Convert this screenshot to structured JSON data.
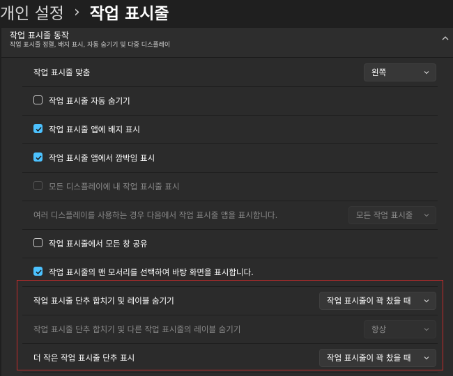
{
  "breadcrumb": {
    "parent": "개인 설정",
    "separator": "›",
    "current": "작업 표시줄"
  },
  "section": {
    "title": "작업 표시줄 동작",
    "subtitle": "작업 표시줄 정렬, 배지 표시, 자동 숨기기 및 다중 디스플레이"
  },
  "rows": {
    "alignment": {
      "label": "작업 표시줄 맞춤",
      "value": "왼쪽"
    },
    "autohide": {
      "label": "작업 표시줄 자동 숨기기",
      "checked": false
    },
    "badges": {
      "label": "작업 표시줄 앱에 배지 표시",
      "checked": true
    },
    "flashing": {
      "label": "작업 표시줄 앱에서 깜박임 표시",
      "checked": true
    },
    "all_displays": {
      "label": "모든 디스플레이에 내 작업 표시줄 표시",
      "checked": false,
      "disabled": true
    },
    "multi_display": {
      "label": "여러 디스플레이를 사용하는 경우 다음에서 작업 표시줄 앱을 표시합니다.",
      "value": "모든 작업 표시줄",
      "disabled": true
    },
    "share_window": {
      "label": "작업 표시줄에서 모든 창 공유",
      "checked": false
    },
    "corner_desktop": {
      "label": "작업 표시줄의 맨 모서리를 선택하여 바탕 화면을 표시합니다.",
      "checked": true
    },
    "combine_buttons": {
      "label": "작업 표시줄 단추 합치기 및 레이블 숨기기",
      "value": "작업 표시줄이 꽉 찼을 때"
    },
    "combine_other": {
      "label": "작업 표시줄 단추 합치기 및 다른 작업 표시줄의 레이블 숨기기",
      "value": "항상",
      "disabled": true
    },
    "smaller_buttons": {
      "label": "더 작은 작업 표시줄 단추 표시",
      "value": "작업 표시줄이 꽉 찼을 때"
    }
  },
  "colors": {
    "accent": "#4cc2ff",
    "highlight_border": "#c42b2b",
    "background": "#1f1f1f",
    "card": "#2b2b2b"
  }
}
